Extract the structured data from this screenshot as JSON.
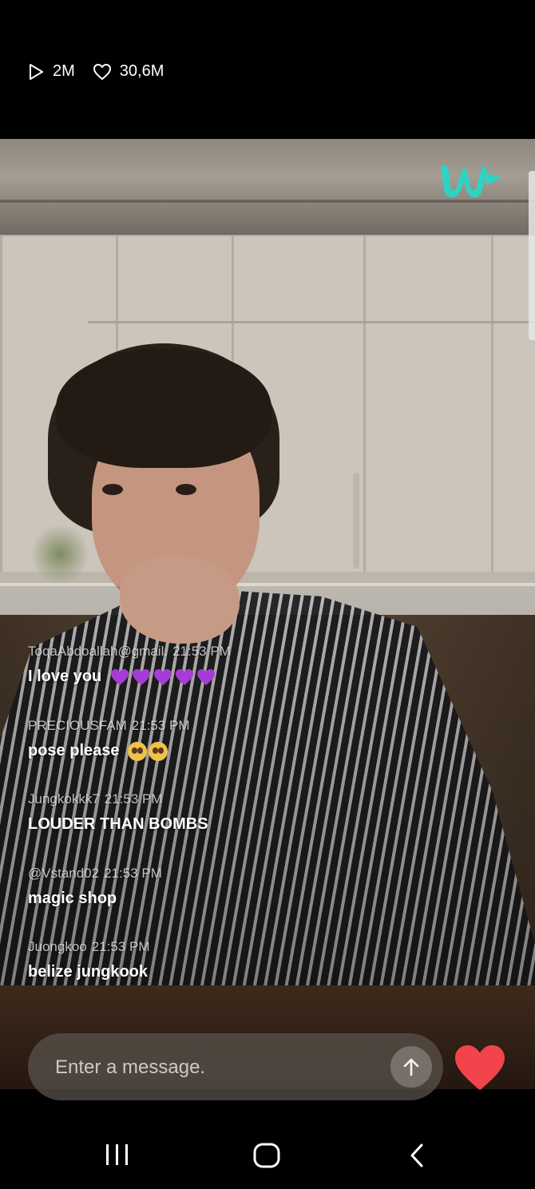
{
  "stats": {
    "views": "2M",
    "likes": "30,6M",
    "views_icon": "play-icon",
    "likes_icon": "heart-outline-icon"
  },
  "brand": {
    "logo_icon": "weverse-logo-icon",
    "accent_color": "#2fd3c3"
  },
  "chat": {
    "messages": [
      {
        "user": "ToqaAbdoallah@gmail.",
        "time": "21:53 PM",
        "text": "I love you",
        "emoji": "purple-heart x5"
      },
      {
        "user": "PRECIOUSFAM",
        "time": "21:53 PM",
        "text": "pose please",
        "emoji": "pleading-face x2"
      },
      {
        "user": "Jungkokkk7",
        "time": "21:53 PM",
        "text": "LOUDER THAN BOMBS"
      },
      {
        "user": "@Vstand02",
        "time": "21:53 PM",
        "text": "magic shop"
      },
      {
        "user": "Juongkoo",
        "time": "21:53 PM",
        "text": "belize jungkook"
      }
    ]
  },
  "composer": {
    "placeholder": "Enter a message.",
    "send_icon": "arrow-up-icon",
    "heart_icon": "heart-filled-icon",
    "heart_color": "#f2444a"
  },
  "navbar": {
    "recents_icon": "recents-icon",
    "home_icon": "home-icon",
    "back_icon": "back-icon"
  }
}
